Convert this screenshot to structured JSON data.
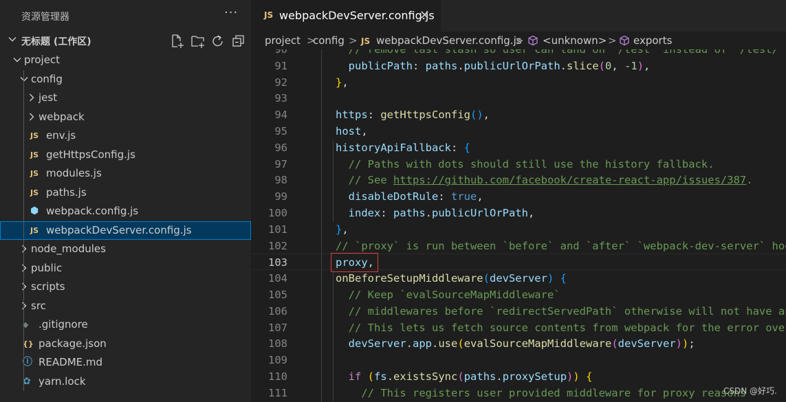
{
  "sidebar": {
    "title": "资源管理器",
    "more": "···",
    "workspace": "无标题 (工作区)",
    "tree": [
      {
        "label": "project",
        "indent": 0,
        "kind": "folder-open"
      },
      {
        "label": "config",
        "indent": 1,
        "kind": "folder-open"
      },
      {
        "label": "jest",
        "indent": 2,
        "kind": "folder"
      },
      {
        "label": "webpack",
        "indent": 2,
        "kind": "folder"
      },
      {
        "label": "env.js",
        "indent": 2,
        "kind": "js"
      },
      {
        "label": "getHttpsConfig.js",
        "indent": 2,
        "kind": "js"
      },
      {
        "label": "modules.js",
        "indent": 2,
        "kind": "js"
      },
      {
        "label": "paths.js",
        "indent": 2,
        "kind": "js"
      },
      {
        "label": "webpack.config.js",
        "indent": 2,
        "kind": "webpack"
      },
      {
        "label": "webpackDevServer.config.js",
        "indent": 2,
        "kind": "js",
        "selected": true
      },
      {
        "label": "node_modules",
        "indent": 1,
        "kind": "folder"
      },
      {
        "label": "public",
        "indent": 1,
        "kind": "folder"
      },
      {
        "label": "scripts",
        "indent": 1,
        "kind": "folder"
      },
      {
        "label": "src",
        "indent": 1,
        "kind": "folder"
      },
      {
        "label": ".gitignore",
        "indent": 1,
        "kind": "git"
      },
      {
        "label": "package.json",
        "indent": 1,
        "kind": "json"
      },
      {
        "label": "README.md",
        "indent": 1,
        "kind": "info"
      },
      {
        "label": "yarn.lock",
        "indent": 1,
        "kind": "yarn"
      }
    ]
  },
  "tab": {
    "badge": "JS",
    "name": "webpackDevServer.config.js",
    "close": "✕"
  },
  "breadcrumb": {
    "items": [
      "project",
      "config",
      "webpackDevServer.config.js",
      "<unknown>",
      "exports"
    ],
    "js_badge": "JS",
    "sep": ">"
  },
  "code": {
    "current_line": 103,
    "lines": [
      {
        "n": 90,
        "tokens": [
          [
            "t-com",
            "  // remove last slash so user can land on `/test` instead of `/test/`"
          ]
        ]
      },
      {
        "n": 91,
        "tokens": [
          [
            "t-key",
            "  publicPath"
          ],
          [
            "t-pun",
            ": "
          ],
          [
            "t-key",
            "paths"
          ],
          [
            "t-pun",
            "."
          ],
          [
            "t-key",
            "publicUrlOrPath"
          ],
          [
            "t-pun",
            "."
          ],
          [
            "t-fn",
            "slice"
          ],
          [
            "t-br2",
            "("
          ],
          [
            "t-num",
            "0"
          ],
          [
            "t-pun",
            ", "
          ],
          [
            "t-num",
            "-1"
          ],
          [
            "t-br2",
            ")"
          ],
          [
            "t-pun",
            ","
          ]
        ]
      },
      {
        "n": 92,
        "tokens": [
          [
            "t-br1",
            "}"
          ],
          [
            "t-pun",
            ","
          ]
        ]
      },
      {
        "n": 93,
        "tokens": []
      },
      {
        "n": 94,
        "tokens": [
          [
            "t-key",
            "https"
          ],
          [
            "t-pun",
            ": "
          ],
          [
            "t-fn",
            "getHttpsConfig"
          ],
          [
            "t-br3",
            "()"
          ],
          [
            "t-pun",
            ","
          ]
        ]
      },
      {
        "n": 95,
        "tokens": [
          [
            "t-key",
            "host"
          ],
          [
            "t-pun",
            ","
          ]
        ]
      },
      {
        "n": 96,
        "tokens": [
          [
            "t-key",
            "historyApiFallback"
          ],
          [
            "t-pun",
            ": "
          ],
          [
            "t-br3",
            "{"
          ]
        ]
      },
      {
        "n": 97,
        "tokens": [
          [
            "t-com",
            "  // Paths with dots should still use the history fallback."
          ]
        ]
      },
      {
        "n": 98,
        "tokens": [
          [
            "t-com",
            "  // See "
          ],
          [
            "t-link",
            "https://github.com/facebook/create-react-app/issues/387"
          ],
          [
            "t-com",
            "."
          ]
        ]
      },
      {
        "n": 99,
        "tokens": [
          [
            "t-key",
            "  disableDotRule"
          ],
          [
            "t-pun",
            ": "
          ],
          [
            "t-bool",
            "true"
          ],
          [
            "t-pun",
            ","
          ]
        ]
      },
      {
        "n": 100,
        "tokens": [
          [
            "t-key",
            "  index"
          ],
          [
            "t-pun",
            ": "
          ],
          [
            "t-key",
            "paths"
          ],
          [
            "t-pun",
            "."
          ],
          [
            "t-key",
            "publicUrlOrPath"
          ],
          [
            "t-pun",
            ","
          ]
        ]
      },
      {
        "n": 101,
        "tokens": [
          [
            "t-br3",
            "}"
          ],
          [
            "t-pun",
            ","
          ]
        ]
      },
      {
        "n": 102,
        "tokens": [
          [
            "t-com",
            "// `proxy` is run between `before` and `after` `webpack-dev-server` hooks"
          ]
        ]
      },
      {
        "n": 103,
        "tokens": [
          [
            "t-key",
            "proxy"
          ],
          [
            "t-pun",
            ","
          ]
        ]
      },
      {
        "n": 104,
        "tokens": [
          [
            "t-fn",
            "onBeforeSetupMiddleware"
          ],
          [
            "t-br3",
            "("
          ],
          [
            "t-key",
            "devServer"
          ],
          [
            "t-br3",
            ")"
          ],
          [
            "t-pun",
            " "
          ],
          [
            "t-br3",
            "{"
          ]
        ]
      },
      {
        "n": 105,
        "tokens": [
          [
            "t-com",
            "  // Keep `evalSourceMapMiddleware`"
          ]
        ]
      },
      {
        "n": 106,
        "tokens": [
          [
            "t-com",
            "  // middlewares before `redirectServedPath` otherwise will not have any effect"
          ]
        ]
      },
      {
        "n": 107,
        "tokens": [
          [
            "t-com",
            "  // This lets us fetch source contents from webpack for the error overlay"
          ]
        ]
      },
      {
        "n": 108,
        "tokens": [
          [
            "t-key",
            "  devServer"
          ],
          [
            "t-pun",
            "."
          ],
          [
            "t-key",
            "app"
          ],
          [
            "t-pun",
            "."
          ],
          [
            "t-fn",
            "use"
          ],
          [
            "t-br1",
            "("
          ],
          [
            "t-fn",
            "evalSourceMapMiddleware"
          ],
          [
            "t-br2",
            "("
          ],
          [
            "t-key",
            "devServer"
          ],
          [
            "t-br2",
            ")"
          ],
          [
            "t-br1",
            ")"
          ],
          [
            "t-pun",
            ";"
          ]
        ]
      },
      {
        "n": 109,
        "tokens": []
      },
      {
        "n": 110,
        "tokens": [
          [
            "t-kw",
            "  if"
          ],
          [
            "t-pun",
            " "
          ],
          [
            "t-br1",
            "("
          ],
          [
            "t-key",
            "fs"
          ],
          [
            "t-pun",
            "."
          ],
          [
            "t-fn",
            "existsSync"
          ],
          [
            "t-br2",
            "("
          ],
          [
            "t-key",
            "paths"
          ],
          [
            "t-pun",
            "."
          ],
          [
            "t-key",
            "proxySetup"
          ],
          [
            "t-br2",
            ")"
          ],
          [
            "t-br1",
            ")"
          ],
          [
            "t-pun",
            " "
          ],
          [
            "t-br1",
            "{"
          ]
        ]
      },
      {
        "n": 111,
        "tokens": [
          [
            "t-com",
            "    // This registers user provided middleware for proxy reasons"
          ]
        ]
      }
    ]
  },
  "watermark": "CSDN @好巧."
}
